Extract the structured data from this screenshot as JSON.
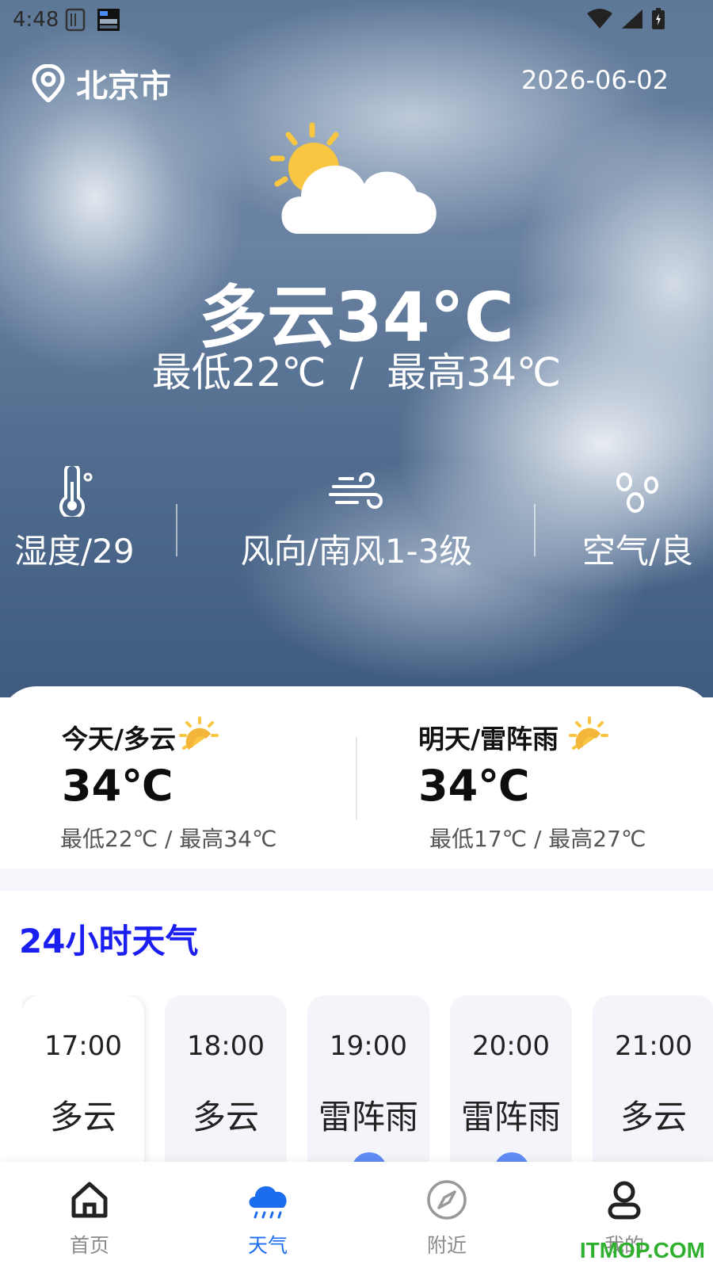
{
  "status_bar": {
    "time": "4:48",
    "icons": [
      "sim-icon",
      "notification-app-icon",
      "wifi-icon",
      "signal-icon",
      "battery-icon"
    ]
  },
  "header": {
    "city": "北京市",
    "date": "2026-06-02",
    "location_icon": "location-pin-icon"
  },
  "current": {
    "icon": "partly-cloudy-icon",
    "title": "多云34°C",
    "min": "最低22℃",
    "separator": "/",
    "max": "最高34℃"
  },
  "stats": [
    {
      "icon": "thermometer-icon",
      "label": "湿度/29"
    },
    {
      "icon": "wind-icon",
      "label": "风向/南风1-3级"
    },
    {
      "icon": "air-drops-icon",
      "label": "空气/良"
    }
  ],
  "days": [
    {
      "title": "今天/多云",
      "temp": "34℃",
      "range": "最低22℃ / 最高34℃",
      "icon": "sun-icon"
    },
    {
      "title": "明天/雷阵雨",
      "temp": "34℃",
      "range": "最低17℃ / 最高27℃",
      "icon": "sun-icon"
    }
  ],
  "section_title": "24小时天气",
  "hours": [
    {
      "time": "17:00",
      "cond": "多云"
    },
    {
      "time": "18:00",
      "cond": "多云"
    },
    {
      "time": "19:00",
      "cond": "雷阵雨"
    },
    {
      "time": "20:00",
      "cond": "雷阵雨"
    },
    {
      "time": "21:00",
      "cond": "多云"
    }
  ],
  "tabs": [
    {
      "label": "首页",
      "icon": "home-icon",
      "active": false
    },
    {
      "label": "天气",
      "icon": "cloud-rain-icon",
      "active": true
    },
    {
      "label": "附近",
      "icon": "compass-icon",
      "active": false
    },
    {
      "label": "我的",
      "icon": "user-icon",
      "active": false
    }
  ],
  "watermark": "ITMOP.COM",
  "colors": {
    "accent": "#1c6cf0",
    "section_title": "#1b1ef0",
    "sun": "#f8c640",
    "hour_dot": "#5f8cf5"
  }
}
